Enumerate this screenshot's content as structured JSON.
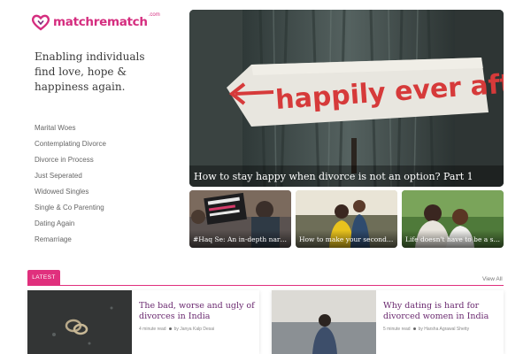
{
  "brand": {
    "name": "matchrematch",
    "tld": ".com",
    "color": "#d52d7f"
  },
  "tagline": "Enabling individuals find love, hope & happiness again.",
  "sidebar": {
    "items": [
      {
        "label": "Marital Woes"
      },
      {
        "label": "Contemplating Divorce"
      },
      {
        "label": "Divorce in Process"
      },
      {
        "label": "Just Seperated"
      },
      {
        "label": "Widowed Singles"
      },
      {
        "label": "Single & Co Parenting"
      },
      {
        "label": "Dating Again"
      },
      {
        "label": "Remarriage"
      }
    ]
  },
  "hero": {
    "title": "How to stay happy when divorce is not an option? Part 1",
    "sign_text": "happily ever after"
  },
  "featured": [
    {
      "title": "#Haq Se: An in-depth narrative on women's rights"
    },
    {
      "title": "How to make your second marriage work"
    },
    {
      "title": "Life doesn't have to be a severe struggle"
    }
  ],
  "latest": {
    "label": "LATEST",
    "view_all": "View All",
    "accent": "#e0307d",
    "articles": [
      {
        "title": "The bad, worse and ugly of divorces in India",
        "read_time": "4 minute read",
        "author": "by Janya Kalp Desai"
      },
      {
        "title": "Why dating is hard for divorced women in India",
        "read_time": "5 minute read",
        "author": "by Harsha Agrawal Shetty"
      }
    ]
  }
}
